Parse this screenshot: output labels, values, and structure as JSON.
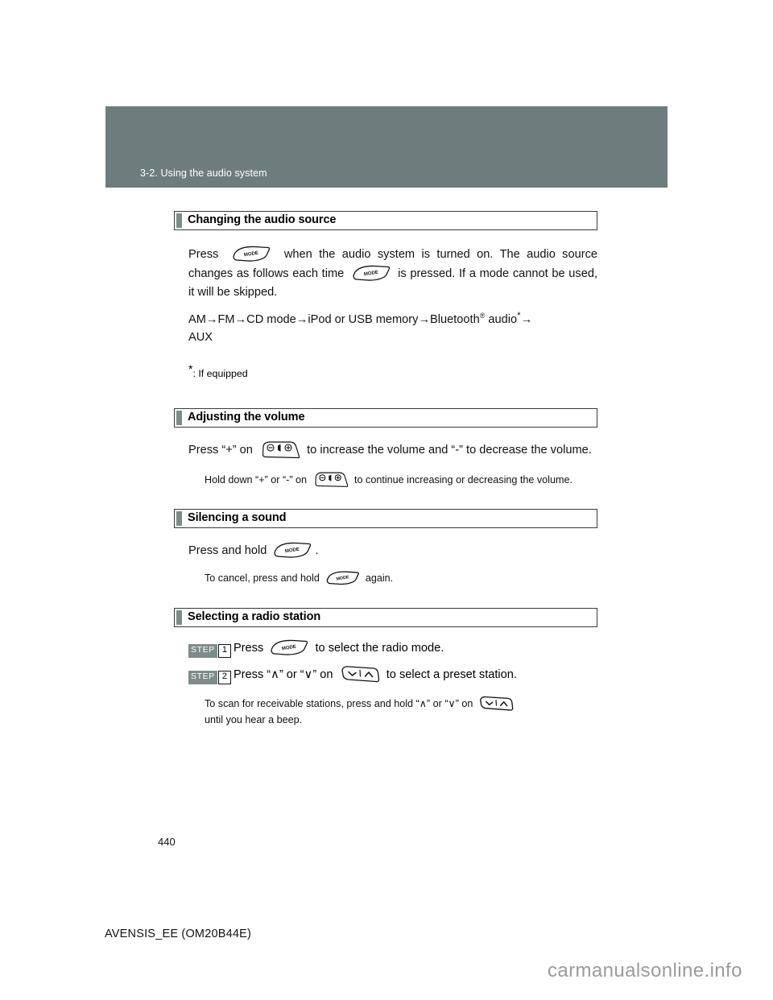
{
  "page": {
    "chapter_header": "3-2. Using the audio system",
    "page_number": "440",
    "footer": "AVENSIS_EE (OM20B44E)",
    "watermark": "carmanualsonline.info",
    "colors": {
      "band": "#6d7d7d",
      "accent_tab": "#7d8c8a",
      "step_badge": "#7d8c8a",
      "text": "#000000",
      "watermark": "#9b9b9b"
    }
  },
  "sections": [
    {
      "id": "changing-the-audio-source",
      "title": "Changing the audio source",
      "paragraph_1_a": "Press",
      "paragraph_1_b": "when the audio system is turned on. The audio source changes as follows each time",
      "paragraph_1_c": "is pressed. If a mode cannot be used, it will be skipped.",
      "source_chain": "AM→FM→CD mode→iPod or USB memory→Bluetooth",
      "source_chain_tail_audio": " audio",
      "source_chain_tail_arrow": "→",
      "source_chain_last": "AUX",
      "footnote_marker": "*",
      "footnote_text": ": If equipped",
      "registered_mark": "®",
      "asterisk": "*"
    },
    {
      "id": "adjusting-the-volume",
      "title": "Adjusting the volume",
      "paragraph_a": "Press “+” on",
      "paragraph_b": "to increase the volume and “-” to decrease the volume.",
      "sub_a": "Hold down “+” or “-” on",
      "sub_b": "to continue increasing or decreasing the volume."
    },
    {
      "id": "silencing-a-sound",
      "title": "Silencing a sound",
      "paragraph_a": "Press and hold",
      "paragraph_b": ".",
      "sub_a": "To cancel, press and hold",
      "sub_b": "again."
    },
    {
      "id": "selecting-a-radio-station",
      "title": "Selecting a radio station",
      "step_word": "STEP",
      "step1_num": "1",
      "step1_a": "Press",
      "step1_b": "to select the radio mode.",
      "step2_num": "2",
      "step2_a": "Press “∧” or “∨” on",
      "step2_b": "to select a preset station.",
      "sub_a": "To scan for receivable stations, press and hold “∧” or “∨” on",
      "sub_b": "until you hear a beep."
    }
  ],
  "buttons": {
    "mode_label": "MODE",
    "volume_minus": "⊖",
    "volume_speaker": "speaker",
    "volume_plus": "⊕",
    "seek_down": "∨",
    "seek_up": "∧"
  }
}
